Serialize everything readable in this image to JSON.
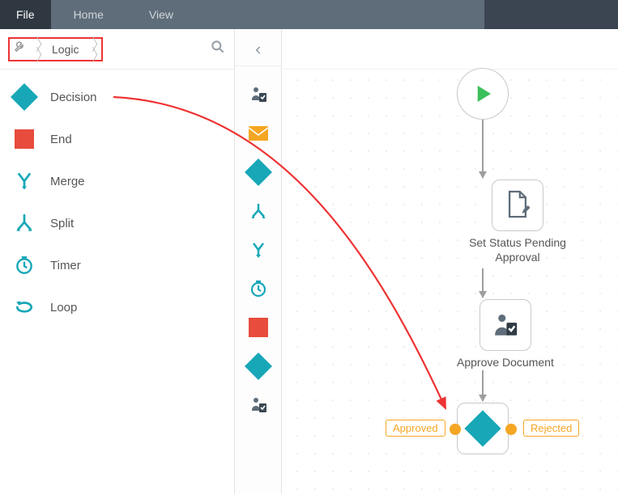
{
  "menubar": {
    "file": "File",
    "home": "Home",
    "view": "View"
  },
  "breadcrumb": {
    "label": "Logic"
  },
  "palette": {
    "decision": "Decision",
    "end": "End",
    "merge": "Merge",
    "split": "Split",
    "timer": "Timer",
    "loop": "Loop"
  },
  "flow": {
    "node_set_status": "Set Status Pending Approval",
    "node_approve": "Approve Document",
    "branch_left": "Approved",
    "branch_right": "Rejected"
  },
  "colors": {
    "accent": "#17a7b7",
    "danger": "#e74c3c",
    "port": "#f5a623",
    "play": "#3bbf5b"
  }
}
